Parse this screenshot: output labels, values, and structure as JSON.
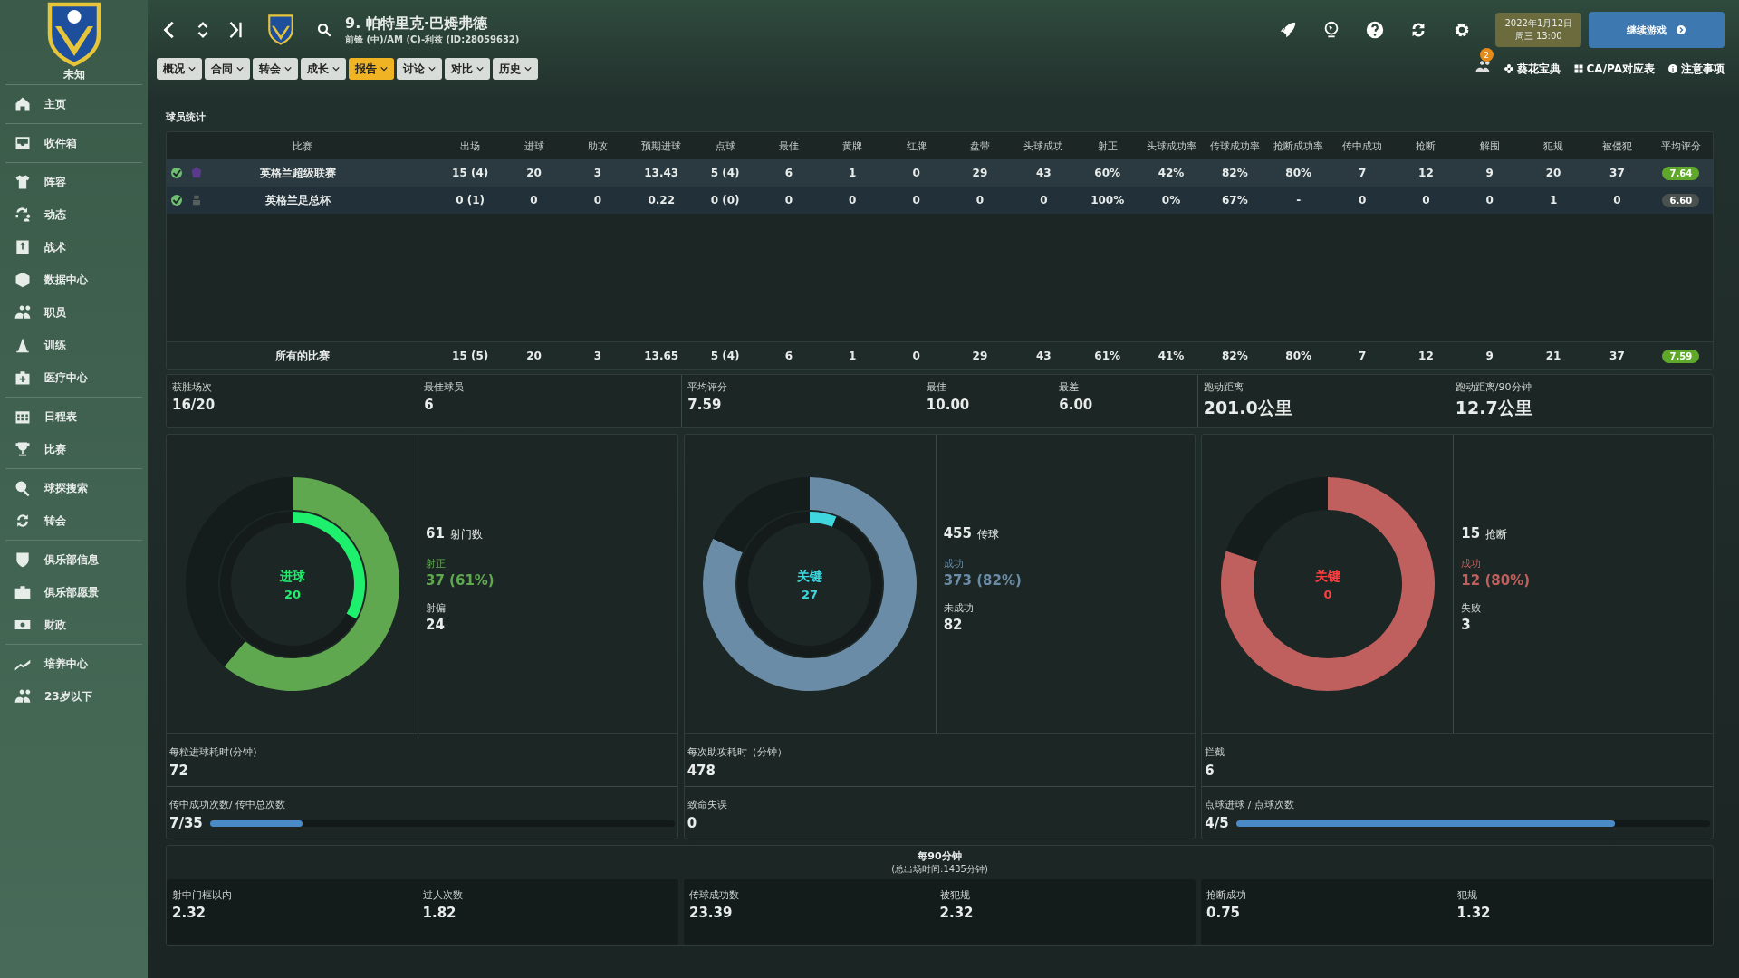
{
  "sidebar": {
    "club": "未知",
    "groups": [
      [
        {
          "label": "主页"
        }
      ],
      [
        {
          "label": "收件箱"
        }
      ],
      [
        {
          "label": "阵容"
        },
        {
          "label": "动态"
        },
        {
          "label": "战术"
        },
        {
          "label": "数据中心"
        },
        {
          "label": "职员"
        },
        {
          "label": "训练"
        },
        {
          "label": "医疗中心"
        }
      ],
      [
        {
          "label": "日程表"
        },
        {
          "label": "比赛"
        }
      ],
      [
        {
          "label": "球探搜索"
        },
        {
          "label": "转会"
        }
      ],
      [
        {
          "label": "俱乐部信息"
        },
        {
          "label": "俱乐部愿景"
        },
        {
          "label": "财政"
        }
      ],
      [
        {
          "label": "培养中心"
        },
        {
          "label": "23岁以下"
        }
      ]
    ]
  },
  "header": {
    "title": "9. 帕特里克·巴姆弗德",
    "subtitle": "前锋 (中)/AM (C)-利兹 (ID:28059632)",
    "date": "2022年1月12日",
    "time": "周三 13:00",
    "continue": "继续游戏"
  },
  "tabs": [
    {
      "label": "概况",
      "selected": false
    },
    {
      "label": "合同",
      "selected": false
    },
    {
      "label": "转会",
      "selected": false
    },
    {
      "label": "成长",
      "selected": false
    },
    {
      "label": "报告",
      "selected": true
    },
    {
      "label": "讨论",
      "selected": false
    },
    {
      "label": "对比",
      "selected": false
    },
    {
      "label": "历史",
      "selected": false
    }
  ],
  "notification_count": "2",
  "links": [
    {
      "label": "葵花宝典"
    },
    {
      "label": "CA/PA对应表"
    },
    {
      "label": "注意事项"
    }
  ],
  "section_title": "球员统计",
  "table": {
    "columns": [
      "比赛",
      "出场",
      "进球",
      "助攻",
      "预期进球",
      "点球",
      "最佳",
      "黄牌",
      "红牌",
      "盘带",
      "头球成功",
      "射正",
      "头球成功率",
      "传球成功率",
      "抢断成功率",
      "传中成功",
      "抢断",
      "解围",
      "犯规",
      "被侵犯",
      "平均评分"
    ],
    "rows": [
      {
        "checked": true,
        "cells": [
          "英格兰超级联赛",
          "15 (4)",
          "20",
          "3",
          "13.43",
          "5 (4)",
          "6",
          "1",
          "0",
          "29",
          "43",
          "60%",
          "42%",
          "82%",
          "80%",
          "7",
          "12",
          "9",
          "20",
          "37"
        ],
        "rating": "7.64",
        "color": "#5fa82a"
      },
      {
        "checked": true,
        "cells": [
          "英格兰足总杯",
          "0 (1)",
          "0",
          "0",
          "0.22",
          "0 (0)",
          "0",
          "0",
          "0",
          "0",
          "0",
          "100%",
          "0%",
          "67%",
          "-",
          "0",
          "0",
          "0",
          "1",
          "0"
        ],
        "rating": "6.60",
        "color": "#4a5250"
      }
    ],
    "total": {
      "cells": [
        "所有的比赛",
        "15 (5)",
        "20",
        "3",
        "13.65",
        "5 (4)",
        "6",
        "1",
        "0",
        "29",
        "43",
        "61%",
        "41%",
        "82%",
        "80%",
        "7",
        "12",
        "9",
        "21",
        "37"
      ],
      "rating": "7.59",
      "color": "#5fa82a"
    }
  },
  "summary": [
    [
      {
        "label": "获胜场次",
        "value": "16/20"
      },
      {
        "label": "最佳球员",
        "value": "6"
      }
    ],
    [
      {
        "label": "平均评分",
        "value": "7.59"
      },
      {
        "label": "最佳",
        "value": "10.00"
      },
      {
        "label": "最差",
        "value": "6.00"
      }
    ],
    [
      {
        "label": "跑动距离",
        "value": "201.0公里"
      },
      {
        "label": "跑动距离/90分钟",
        "value": "12.7公里"
      }
    ]
  ],
  "panels": [
    {
      "donut": {
        "label": "进球",
        "value": "20",
        "chart_data": {
          "type": "donut",
          "values": [
            61,
            39
          ]
        },
        "inner": {
          "chart_data": {
            "type": "donut",
            "values": [
              33,
              67
            ]
          }
        }
      },
      "total": "61",
      "total_label": "射门数",
      "success_label": "射正",
      "success_value": "37 (61%)",
      "fail_label": "射偏",
      "fail_value": "24",
      "stat": {
        "label": "每粒进球耗时(分钟)",
        "value": "72"
      },
      "ratio": {
        "label": "传中成功次数/ 传中总次数",
        "value": "7/35",
        "bar": {
          "level": 0.2
        }
      }
    },
    {
      "donut": {
        "label": "关键",
        "value": "27",
        "chart_data": {
          "type": "donut",
          "values": [
            82,
            18
          ]
        },
        "inner": {
          "chart_data": {
            "type": "donut",
            "values": [
              6,
              94
            ]
          }
        }
      },
      "total": "455",
      "total_label": "传球",
      "success_label": "成功",
      "success_value": "373 (82%)",
      "fail_label": "未成功",
      "fail_value": "82",
      "stat": {
        "label": "每次助攻耗时（分钟）",
        "value": "478"
      },
      "ratio": {
        "label": "致命失误",
        "value": "0"
      }
    },
    {
      "donut": {
        "label": "关键",
        "value": "0",
        "chart_data": {
          "type": "donut",
          "values": [
            80,
            20
          ]
        }
      },
      "total": "15",
      "total_label": "抢断",
      "success_label": "成功",
      "success_value": "12 (80%)",
      "fail_label": "失败",
      "fail_value": "3",
      "stat": {
        "label": "拦截",
        "value": "6"
      },
      "ratio": {
        "label": "点球进球 / 点球次数",
        "value": "4/5",
        "bar": {
          "level": 0.8
        }
      }
    }
  ],
  "per90": {
    "title": "每90分钟",
    "subtitle": "(总出场时间:1435分钟)",
    "groups": [
      [
        {
          "label": "射中门框以内",
          "value": "2.32"
        },
        {
          "label": "过人次数",
          "value": "1.82"
        }
      ],
      [
        {
          "label": "传球成功数",
          "value": "23.39"
        },
        {
          "label": "被犯规",
          "value": "2.32"
        }
      ],
      [
        {
          "label": "抢断成功",
          "value": "0.75"
        },
        {
          "label": "犯规",
          "value": "1.32"
        }
      ]
    ]
  }
}
